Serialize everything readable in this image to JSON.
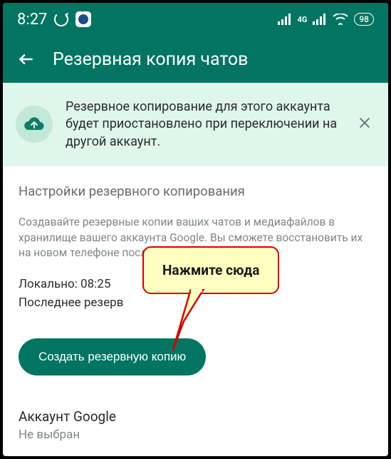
{
  "status": {
    "time": "8:27",
    "battery": "98"
  },
  "header": {
    "title": "Резервная копия чатов"
  },
  "banner": {
    "text": "Резервное копирование для этого аккаунта будет приостановлено при переключении на другой аккаунт."
  },
  "settings": {
    "title": "Настройки резервного копирования",
    "description": "Создавайте резервные копии ваших чатов и медиафайлов в хранилище вашего аккаунта Google. Вы сможете восстановить их на новом телефоне после скачивания WhatsApp.",
    "local_label": "Локально: 08:25",
    "last_label": "Последнее резерв",
    "backup_button": "Создать резервную копию"
  },
  "account": {
    "label": "Аккаунт Google",
    "value": "Не выбран"
  },
  "callout": {
    "text": "Нажмите сюда"
  }
}
